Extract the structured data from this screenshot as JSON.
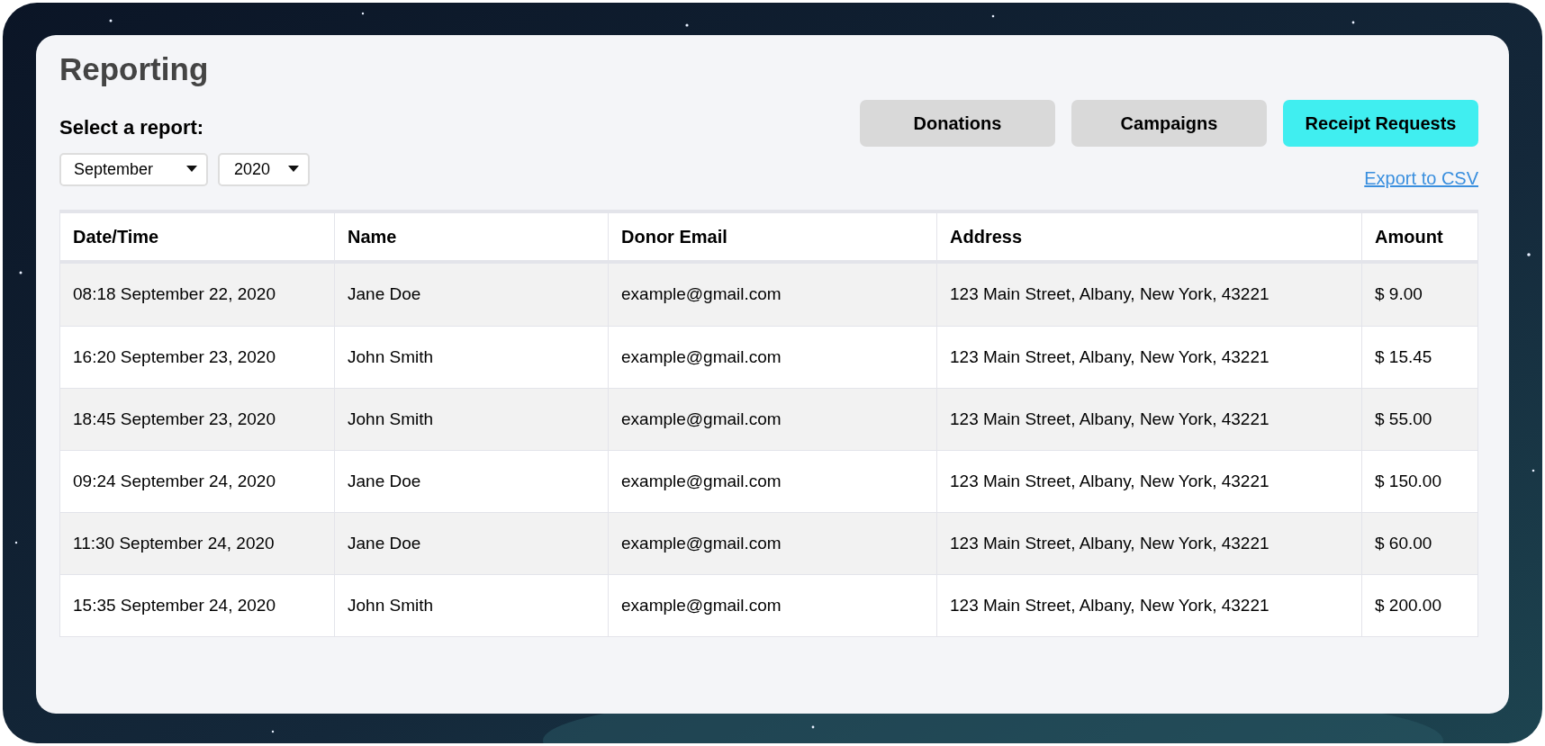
{
  "page": {
    "title": "Reporting"
  },
  "report_select": {
    "label": "Select a report:",
    "month": "September",
    "year": "2020"
  },
  "tabs": [
    {
      "label": "Donations",
      "selected": false
    },
    {
      "label": "Campaigns",
      "selected": false
    },
    {
      "label": "Receipt Requests",
      "selected": true
    }
  ],
  "export_link": "Export to CSV",
  "table": {
    "columns": [
      "Date/Time",
      "Name",
      "Donor Email",
      "Address",
      "Amount"
    ],
    "rows": [
      [
        "08:18 September 22, 2020",
        "Jane Doe",
        "example@gmail.com",
        "123 Main Street, Albany, New York, 43221",
        "$ 9.00"
      ],
      [
        "16:20 September 23, 2020",
        "John Smith",
        "example@gmail.com",
        "123 Main Street, Albany, New York, 43221",
        "$ 15.45"
      ],
      [
        "18:45 September 23, 2020",
        "John Smith",
        "example@gmail.com",
        "123 Main Street, Albany, New York, 43221",
        "$ 55.00"
      ],
      [
        "09:24 September 24, 2020",
        "Jane Doe",
        "example@gmail.com",
        "123 Main Street, Albany, New York, 43221",
        "$ 150.00"
      ],
      [
        "11:30 September 24, 2020",
        "Jane Doe",
        "example@gmail.com",
        "123 Main Street, Albany, New York, 43221",
        "$ 60.00"
      ],
      [
        "15:35 September 24, 2020",
        "John Smith",
        "example@gmail.com",
        "123 Main Street, Albany, New York, 43221",
        "$ 200.00"
      ]
    ]
  }
}
